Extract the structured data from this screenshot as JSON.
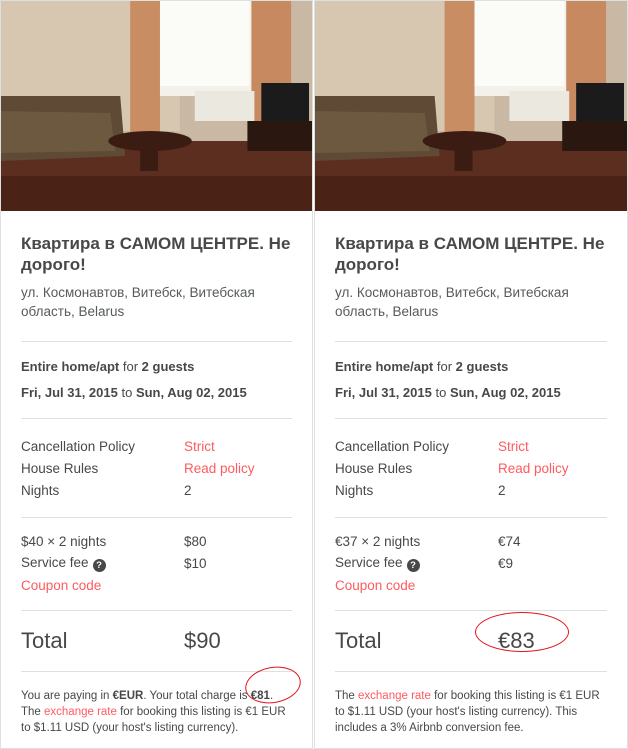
{
  "colors": {
    "accent": "#ff5a5f",
    "annotation": "#e0141e",
    "text": "#484848",
    "divider": "#dce0e0"
  },
  "left": {
    "title": "Квартира в САМОМ ЦЕНТРЕ. Не дорого!",
    "address": "ул. Космонавтов, Витебск, Витебская область, Belarus",
    "room_type": "Entire home/apt",
    "guests_connector": "for",
    "guests": "2 guests",
    "checkin": "Fri, Jul 31, 2015",
    "dates_connector": "to",
    "checkout": "Sun, Aug 02, 2015",
    "rows": {
      "cancellation_label": "Cancellation Policy",
      "cancellation_value": "Strict",
      "house_rules_label": "House Rules",
      "house_rules_value": "Read policy",
      "nights_label": "Nights",
      "nights_value": "2"
    },
    "price_label": "$40 × 2 nights",
    "price_value": "$80",
    "service_fee_label": "Service fee",
    "service_fee_value": "$10",
    "help_icon": "question-mark-icon",
    "coupon_label": "Coupon code",
    "total_label": "Total",
    "total_value": "$90",
    "note_part1": "You are paying in ",
    "note_currency": "€EUR",
    "note_part2": ". Your total charge is ",
    "note_charge": "€81",
    "note_part3": ".",
    "note_link": "exchange rate",
    "note_part4": "The ",
    "note_part5": " for booking this listing is €1 EUR to $1.11 USD (your host's listing currency)."
  },
  "right": {
    "title": "Квартира в САМОМ ЦЕНТРЕ. Не дорого!",
    "address": "ул. Космонавтов, Витебск, Витебская область, Belarus",
    "room_type": "Entire home/apt",
    "guests_connector": "for",
    "guests": "2 guests",
    "checkin": "Fri, Jul 31, 2015",
    "dates_connector": "to",
    "checkout": "Sun, Aug 02, 2015",
    "rows": {
      "cancellation_label": "Cancellation Policy",
      "cancellation_value": "Strict",
      "house_rules_label": "House Rules",
      "house_rules_value": "Read policy",
      "nights_label": "Nights",
      "nights_value": "2"
    },
    "price_label": "€37 × 2 nights",
    "price_value": "€74",
    "service_fee_label": "Service fee",
    "service_fee_value": "€9",
    "help_icon": "question-mark-icon",
    "coupon_label": "Coupon code",
    "total_label": "Total",
    "total_value": "€83",
    "note_part4": "The ",
    "note_link": "exchange rate",
    "note_part5": " for booking this listing is €1 EUR to $1.11 USD (your host's listing currency). This includes a 3% Airbnb conversion fee."
  }
}
